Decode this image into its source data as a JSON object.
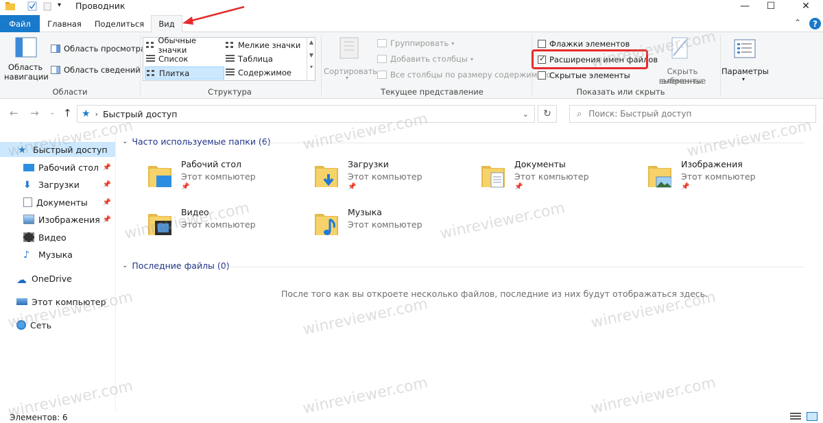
{
  "window": {
    "title": "Проводник",
    "controls": {
      "minimize": "—",
      "maximize": "☐",
      "close": "✕"
    }
  },
  "tabs": {
    "file": "Файл",
    "home": "Главная",
    "share": "Поделиться",
    "view": "Вид",
    "collapse": "⌃",
    "help": "?"
  },
  "ribbon": {
    "panes": {
      "nav_pane": "Область навигации",
      "preview": "Область просмотра",
      "details": "Область сведений",
      "label": "Области"
    },
    "layout": {
      "items": [
        "Обычные значки",
        "Мелкие значки",
        "Список",
        "Таблица",
        "Плитка",
        "Содержимое"
      ],
      "selected": "Плитка",
      "label": "Структура"
    },
    "current_view": {
      "sort": "Сортировать",
      "group": "Группировать",
      "add_columns": "Добавить столбцы",
      "size_columns": "Все столбцы по размеру содержимого",
      "label": "Текущее представление"
    },
    "show_hide": {
      "checkboxes": [
        {
          "label": "Флажки элементов",
          "checked": false
        },
        {
          "label": "Расширения имен файлов",
          "checked": true
        },
        {
          "label": "Скрытые элементы",
          "checked": false
        }
      ],
      "hide_selected_1": "Скрыть выбранные",
      "hide_selected_2": "элементы",
      "label": "Показать или скрыть"
    },
    "options": "Параметры"
  },
  "address": {
    "path": "Быстрый доступ",
    "search_placeholder": "Поиск: Быстрый доступ"
  },
  "nav": {
    "items": [
      {
        "label": "Быстрый доступ",
        "icon": "star-icon",
        "selected": true
      },
      {
        "label": "Рабочий стол",
        "icon": "desktop-icon",
        "pinned": true
      },
      {
        "label": "Загрузки",
        "icon": "download-icon",
        "pinned": true
      },
      {
        "label": "Документы",
        "icon": "document-icon",
        "pinned": true
      },
      {
        "label": "Изображения",
        "icon": "pictures-icon",
        "pinned": true
      },
      {
        "label": "Видео",
        "icon": "video-icon"
      },
      {
        "label": "Музыка",
        "icon": "music-icon"
      },
      {
        "label": "OneDrive",
        "icon": "cloud-icon"
      },
      {
        "label": "Этот компьютер",
        "icon": "computer-icon"
      },
      {
        "label": "Сеть",
        "icon": "network-icon"
      }
    ]
  },
  "content": {
    "frequent_header": "Часто используемые папки (6)",
    "recent_header": "Последние файлы (0)",
    "folders": [
      {
        "name": "Рабочий стол",
        "location": "Этот компьютер"
      },
      {
        "name": "Загрузки",
        "location": "Этот компьютер"
      },
      {
        "name": "Документы",
        "location": "Этот компьютер"
      },
      {
        "name": "Изображения",
        "location": "Этот компьютер"
      },
      {
        "name": "Видео",
        "location": "Этот компьютер"
      },
      {
        "name": "Музыка",
        "location": "Этот компьютер"
      }
    ],
    "empty_message": "После того как вы откроете несколько файлов, последние из них будут отображаться здесь."
  },
  "status": {
    "items": "Элементов: 6"
  },
  "watermark": "winreviewer.com",
  "colors": {
    "accent": "#1979ca",
    "highlight": "#e52b2b",
    "selection": "#cce8ff",
    "folder": "#f6d36a"
  }
}
